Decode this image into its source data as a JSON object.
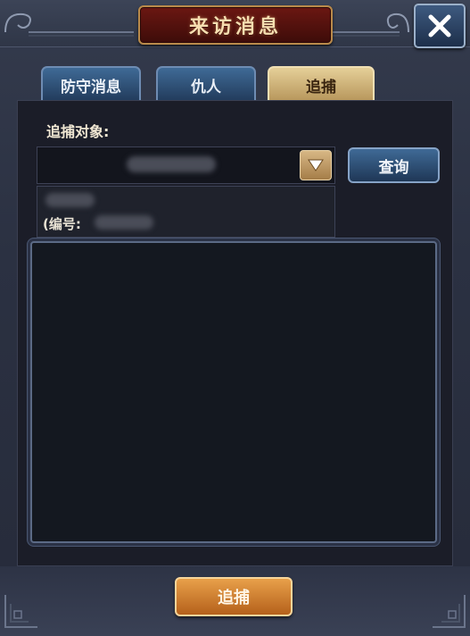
{
  "window": {
    "title": "来访消息",
    "close_icon": "close-icon"
  },
  "tabs": [
    {
      "label": "防守消息",
      "state": "inactive"
    },
    {
      "label": "仇人",
      "state": "inactive"
    },
    {
      "label": "追捕",
      "state": "active"
    }
  ],
  "target": {
    "label": "追捕对象:",
    "selected_value": "",
    "dropdown_icon": "triangle-down-icon",
    "query_label": "查询"
  },
  "info": {
    "id_prefix": "(编号:"
  },
  "footer": {
    "pursue_label": "追捕"
  },
  "colors": {
    "accent_gold": "#b98a4a",
    "title_red": "#6b1712",
    "button_blue": "#3f6a96",
    "button_orange": "#e8a04a"
  }
}
